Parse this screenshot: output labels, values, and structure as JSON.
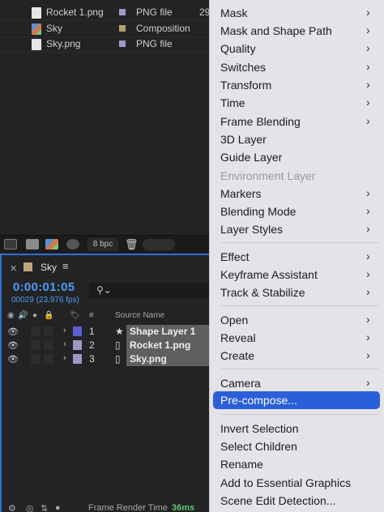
{
  "project": {
    "rows": [
      {
        "name": "Rocket 1.png",
        "type": "PNG file",
        "size": "29",
        "icon": "png-file-icon",
        "label_color": "#9c99c7"
      },
      {
        "name": "Sky",
        "type": "Composition",
        "size": "",
        "icon": "composition-icon",
        "label_color": "#b29e70"
      },
      {
        "name": "Sky.png",
        "type": "PNG file",
        "size": "",
        "icon": "png-file-icon",
        "label_color": "#9c99c7"
      }
    ],
    "footer": {
      "bpc": "8 bpc"
    }
  },
  "timeline": {
    "tab_name": "Sky",
    "timecode": "0:00:01:05",
    "frames": "00029 (23.976 fps)",
    "header": {
      "hash": "#",
      "source_name": "Source Name"
    },
    "layers": [
      {
        "num": "1",
        "name": "Shape Layer 1",
        "type_icon": "star-icon",
        "label_color": "#5a5fd1"
      },
      {
        "num": "2",
        "name": "Rocket 1.png",
        "type_icon": "png-file-icon",
        "label_color": "#9c99c7"
      },
      {
        "num": "3",
        "name": "Sky.png",
        "type_icon": "png-file-icon",
        "label_color": "#9c99c7"
      }
    ],
    "footer": {
      "frame_render_label": "Frame Render Time",
      "frame_render_value": "36ms",
      "value_color": "#59c97a"
    }
  },
  "menu": {
    "items": [
      {
        "label": "Mask",
        "submenu": true
      },
      {
        "label": "Mask and Shape Path",
        "submenu": true
      },
      {
        "label": "Quality",
        "submenu": true
      },
      {
        "label": "Switches",
        "submenu": true
      },
      {
        "label": "Transform",
        "submenu": true
      },
      {
        "label": "Time",
        "submenu": true
      },
      {
        "label": "Frame Blending",
        "submenu": true
      },
      {
        "label": "3D Layer",
        "submenu": false
      },
      {
        "label": "Guide Layer",
        "submenu": false
      },
      {
        "label": "Environment Layer",
        "submenu": false,
        "disabled": true
      },
      {
        "label": "Markers",
        "submenu": true
      },
      {
        "label": "Blending Mode",
        "submenu": true
      },
      {
        "label": "Layer Styles",
        "submenu": true
      },
      {
        "label": "Effect",
        "submenu": true
      },
      {
        "label": "Keyframe Assistant",
        "submenu": true
      },
      {
        "label": "Track & Stabilize",
        "submenu": true
      },
      {
        "label": "Open",
        "submenu": true
      },
      {
        "label": "Reveal",
        "submenu": true
      },
      {
        "label": "Create",
        "submenu": true
      },
      {
        "label": "Camera",
        "submenu": true
      },
      {
        "label": "Pre-compose...",
        "submenu": false,
        "selected": true
      },
      {
        "label": "Invert Selection",
        "submenu": false
      },
      {
        "label": "Select Children",
        "submenu": false
      },
      {
        "label": "Rename",
        "submenu": false
      },
      {
        "label": "Add to Essential Graphics",
        "submenu": false
      },
      {
        "label": "Scene Edit Detection...",
        "submenu": false
      }
    ],
    "accent": "#2a5fd9"
  }
}
